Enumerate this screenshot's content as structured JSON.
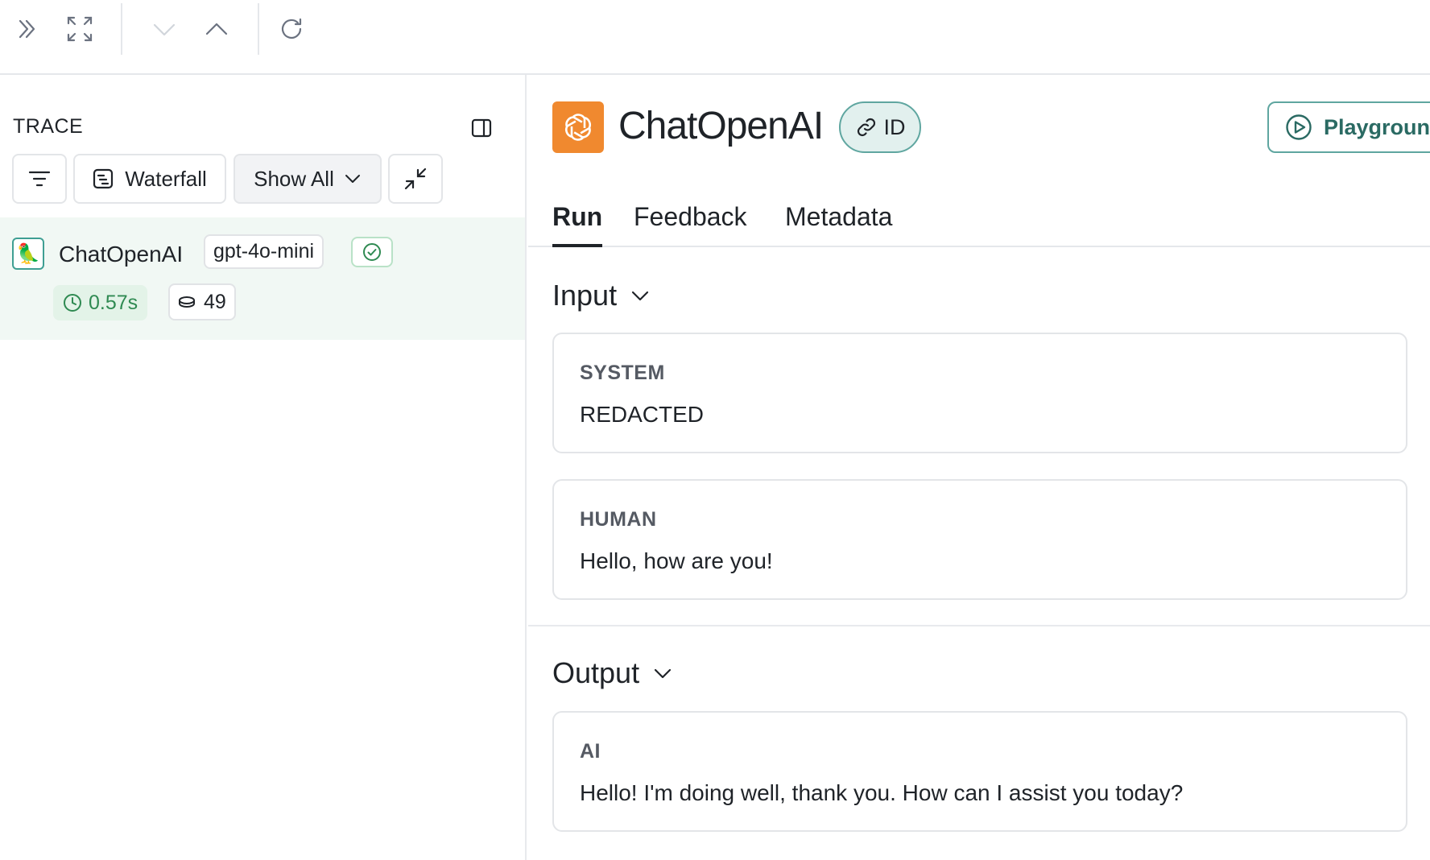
{
  "toolbar": {
    "expand_icon": "chevrons-right-icon",
    "fullscreen_icon": "maximize-icon",
    "prev_icon": "chevron-down-icon",
    "next_icon": "chevron-up-icon",
    "refresh_icon": "refresh-icon"
  },
  "trace_panel": {
    "title": "TRACE",
    "panel_toggle_icon": "sidebar-icon",
    "filter_icon": "filter-icon",
    "view_mode_label": "Waterfall",
    "show_label": "Show All",
    "collapse_icon": "minimize-icon",
    "run": {
      "name": "ChatOpenAI",
      "model": "gpt-4o-mini",
      "status": "success",
      "latency": "0.57s",
      "tokens": "49",
      "icon": "parrot-icon"
    }
  },
  "detail": {
    "title": "ChatOpenAI",
    "id_label": "ID",
    "playground_label": "Playground",
    "tabs": [
      {
        "label": "Run",
        "active": true
      },
      {
        "label": "Feedback",
        "active": false
      },
      {
        "label": "Metadata",
        "active": false
      }
    ],
    "input": {
      "header": "Input",
      "messages": [
        {
          "role": "SYSTEM",
          "text": "REDACTED"
        },
        {
          "role": "HUMAN",
          "text": "Hello, how are you!"
        }
      ]
    },
    "output": {
      "header": "Output",
      "messages": [
        {
          "role": "AI",
          "text": "Hello! I'm doing well, thank you. How can I assist you today?"
        }
      ]
    }
  },
  "colors": {
    "accent_teal": "#5fa6a0",
    "openai_orange": "#f0892f",
    "success_green": "#2f8a52",
    "row_highlight": "#f1f8f4"
  }
}
